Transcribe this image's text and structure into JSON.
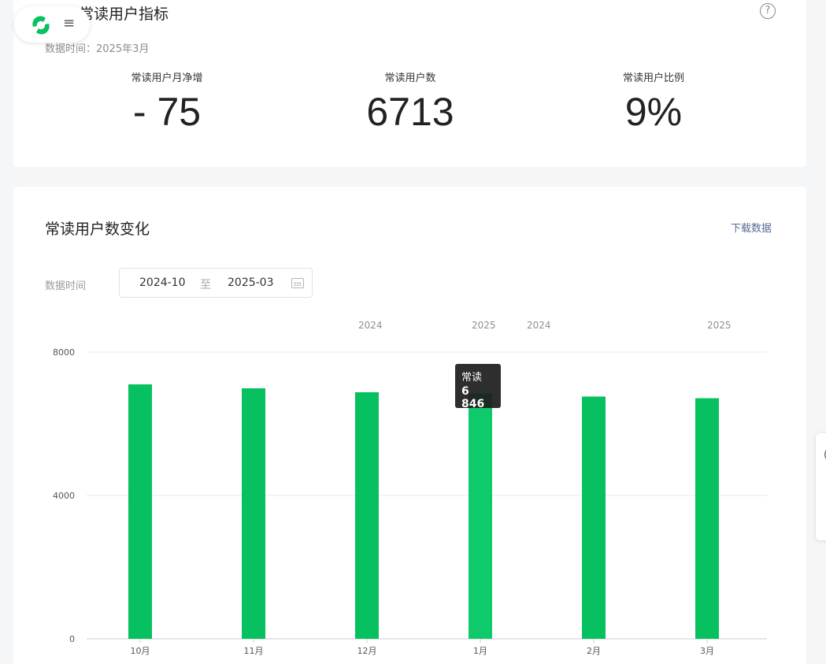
{
  "summary": {
    "title": "常读用户指标",
    "data_time": "数据时间：2025年3月",
    "help_glyph": "?",
    "metrics": [
      {
        "label": "常读用户月净增",
        "value": "- 75"
      },
      {
        "label": "常读用户数",
        "value": "6713"
      },
      {
        "label": "常读用户比例",
        "value": "9%"
      }
    ]
  },
  "header": {
    "menu_glyph": "≡"
  },
  "trend": {
    "title": "常读用户数变化",
    "download_label": "下载数据",
    "range_label": "数据时间",
    "range_start": "2024-10",
    "range_sep": "至",
    "range_end": "2025-03",
    "year_labels": [
      "2024",
      "2025",
      "2024",
      "2025"
    ]
  },
  "tooltip": {
    "series": "常读",
    "value": "6 846"
  },
  "side_tab": {
    "text": "("
  },
  "colors": {
    "accent": "#07c160",
    "bar_highlight": "#0fca6a",
    "link": "#576b95"
  },
  "chart_data": {
    "type": "bar",
    "categories": [
      "10月",
      "11月",
      "12月",
      "1月",
      "2月",
      "3月"
    ],
    "series": [
      {
        "name": "常读",
        "values": [
          7100,
          6990,
          6880,
          6846,
          6760,
          6713
        ]
      }
    ],
    "ylim": [
      0,
      8000
    ],
    "yticks": [
      0,
      4000,
      8000
    ],
    "grid": true,
    "highlight_index": 3
  }
}
